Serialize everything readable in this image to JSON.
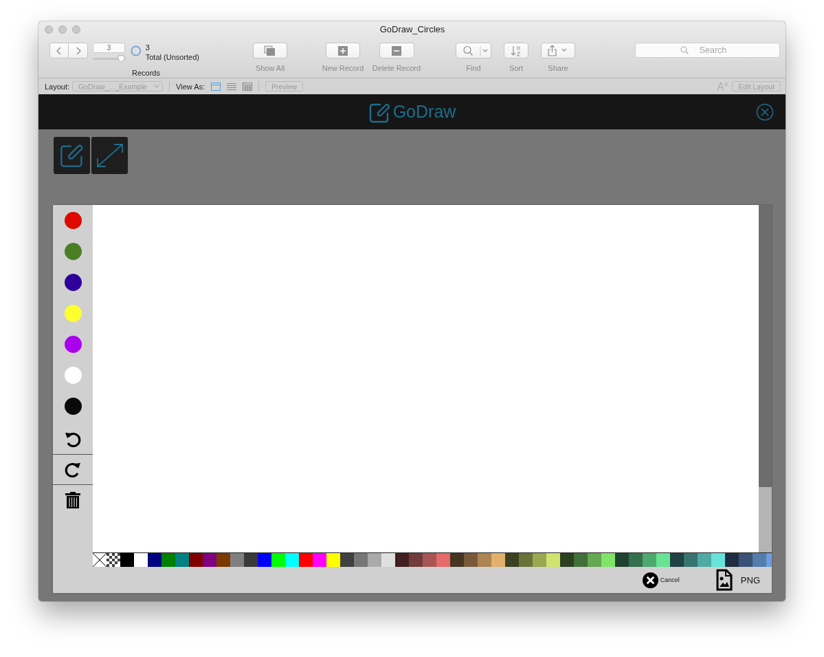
{
  "window": {
    "title": "GoDraw_Circles"
  },
  "toolbar": {
    "record_field": "3",
    "record_slider": {
      "level": 1
    },
    "found_count": "3",
    "found_label": "Total (Unsorted)",
    "records_label": "Records",
    "buttons": [
      {
        "kind": "showall",
        "label": "Show All",
        "disabled": true
      },
      {
        "kind": "new",
        "label": "New Record",
        "disabled": true
      },
      {
        "kind": "delete",
        "label": "Delete Record",
        "disabled": true
      },
      {
        "kind": "find",
        "label": "Find",
        "disabled": true
      },
      {
        "kind": "sort",
        "label": "Sort",
        "disabled": true
      },
      {
        "kind": "share",
        "label": "Share",
        "disabled": true
      }
    ],
    "search": {
      "placeholder": "Search"
    }
  },
  "layout_bar": {
    "layout_label": "Layout:",
    "layout_value": "GoDraw_..._Example",
    "view_as_label": "View As:",
    "view_modes": [
      {
        "kind": "form",
        "selected": true
      },
      {
        "kind": "list",
        "selected": false
      },
      {
        "kind": "table",
        "selected": false
      }
    ],
    "preview": "Preview",
    "edit_layout": "Edit Layout"
  },
  "header": {
    "logo": "GoDraw"
  },
  "pen_colors": [
    {
      "color": "#dd0a00"
    },
    {
      "color": "#4a7f24"
    },
    {
      "color": "#2e0099"
    },
    {
      "color": "#ffff2e"
    },
    {
      "color": "#aa00ee"
    },
    {
      "color": "#ffffff"
    },
    {
      "color": "#0a0a0a"
    }
  ],
  "tools": [
    {
      "kind": "undo"
    },
    {
      "kind": "redo"
    },
    {
      "kind": "trash"
    }
  ],
  "palette": [
    {
      "kind": "none"
    },
    {
      "kind": "checker"
    },
    {
      "color": "#000000"
    },
    {
      "color": "#ffffff"
    },
    {
      "color": "#000080"
    },
    {
      "color": "#008000"
    },
    {
      "color": "#008080"
    },
    {
      "color": "#800000"
    },
    {
      "color": "#800080"
    },
    {
      "color": "#7a3a00"
    },
    {
      "color": "#808080"
    },
    {
      "color": "#3a3a3a"
    },
    {
      "color": "#0000ff"
    },
    {
      "color": "#00ff00"
    },
    {
      "color": "#00ffff"
    },
    {
      "color": "#ff0000"
    },
    {
      "color": "#ff00ff"
    },
    {
      "color": "#ffff00"
    },
    {
      "color": "#404040"
    },
    {
      "color": "#767676"
    },
    {
      "color": "#aaaaaa"
    },
    {
      "color": "#e0e0e0"
    },
    {
      "color": "#42201f"
    },
    {
      "color": "#733c3c"
    },
    {
      "color": "#a85555"
    },
    {
      "color": "#e56a6a"
    },
    {
      "color": "#453622"
    },
    {
      "color": "#775a3a"
    },
    {
      "color": "#ad8452"
    },
    {
      "color": "#e3b06e"
    },
    {
      "color": "#3d4121"
    },
    {
      "color": "#67733a"
    },
    {
      "color": "#9aa852"
    },
    {
      "color": "#d0e36d"
    },
    {
      "color": "#2a4020"
    },
    {
      "color": "#41713a"
    },
    {
      "color": "#64a852"
    },
    {
      "color": "#82e36a"
    },
    {
      "color": "#204230"
    },
    {
      "color": "#34704d"
    },
    {
      "color": "#4fa86e"
    },
    {
      "color": "#68e393"
    },
    {
      "color": "#204244"
    },
    {
      "color": "#377470"
    },
    {
      "color": "#4faaa5"
    },
    {
      "color": "#68e3da"
    },
    {
      "color": "#202c42"
    },
    {
      "color": "#3a5275"
    },
    {
      "color": "#537dab"
    },
    {
      "color": "#6a9de3"
    }
  ],
  "actions": [
    {
      "kind": "cancel",
      "label": "Cancel"
    },
    {
      "kind": "png",
      "label": "PNG"
    }
  ]
}
